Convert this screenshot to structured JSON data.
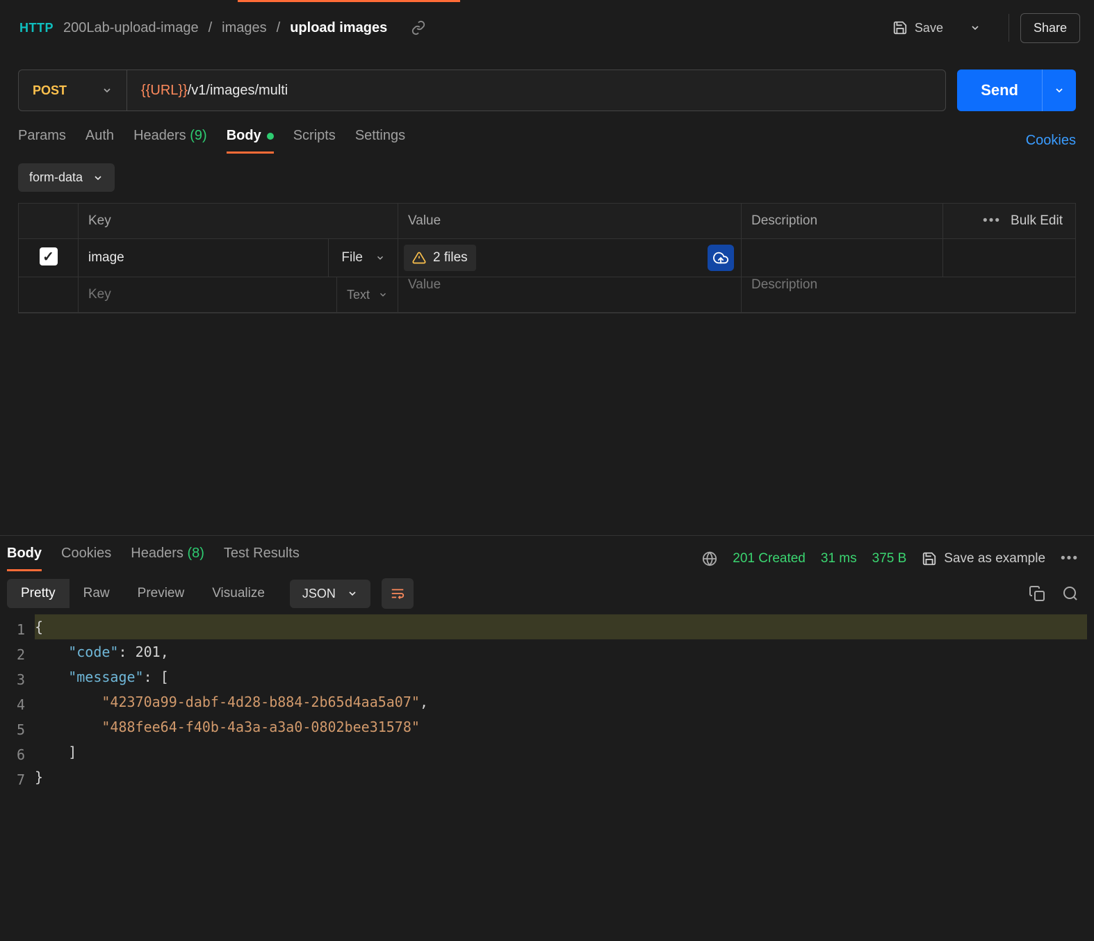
{
  "breadcrumb": {
    "root": "200Lab-upload-image",
    "mid": "images",
    "leaf": "upload images"
  },
  "header": {
    "save": "Save",
    "share": "Share"
  },
  "request": {
    "method": "POST",
    "url_var": "{{URL}}",
    "url_path": "/v1/images/multi",
    "send": "Send"
  },
  "tabs": {
    "params": "Params",
    "auth": "Auth",
    "headers_label": "Headers",
    "headers_count": "(9)",
    "body": "Body",
    "scripts": "Scripts",
    "settings": "Settings",
    "cookies": "Cookies"
  },
  "body_type": "form-data",
  "table": {
    "key_header": "Key",
    "value_header": "Value",
    "desc_header": "Description",
    "bulk_edit": "Bulk Edit",
    "row1": {
      "key": "image",
      "type": "File",
      "files_label": "2 files"
    },
    "row2": {
      "key_placeholder": "Key",
      "type": "Text",
      "value_placeholder": "Value",
      "desc_placeholder": "Description"
    }
  },
  "response": {
    "tabs": {
      "body": "Body",
      "cookies": "Cookies",
      "headers_label": "Headers",
      "headers_count": "(8)",
      "test_results": "Test Results"
    },
    "status": "201 Created",
    "time": "31 ms",
    "size": "375 B",
    "save_example": "Save as example",
    "modes": {
      "pretty": "Pretty",
      "raw": "Raw",
      "preview": "Preview",
      "visualize": "Visualize",
      "format": "JSON"
    },
    "lines": [
      "1",
      "2",
      "3",
      "4",
      "5",
      "6",
      "7"
    ],
    "json": {
      "code_key": "\"code\"",
      "code_val": "201",
      "message_key": "\"message\"",
      "msg1": "\"42370a99-dabf-4d28-b884-2b65d4aa5a07\"",
      "msg2": "\"488fee64-f40b-4a3a-a3a0-0802bee31578\""
    }
  }
}
